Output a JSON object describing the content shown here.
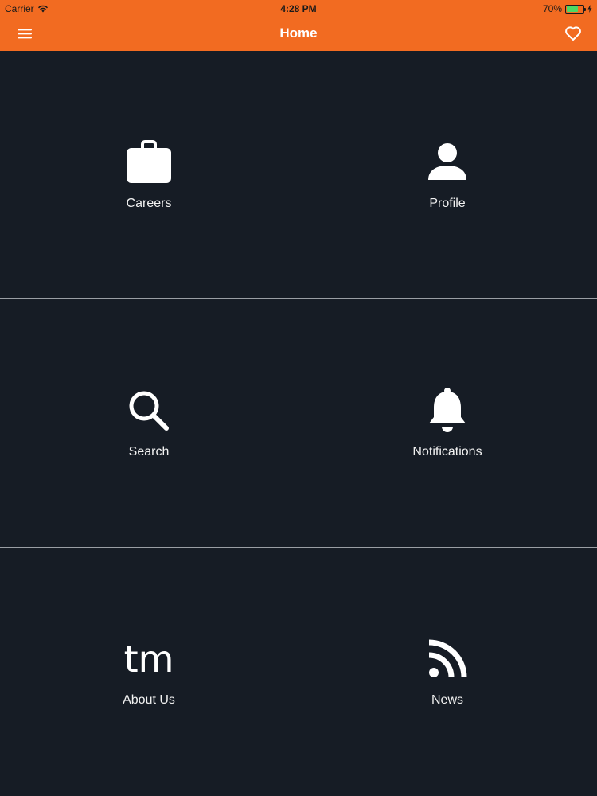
{
  "status": {
    "carrier": "Carrier",
    "time": "4:28 PM",
    "battery_text": "70%",
    "battery_level": 0.7
  },
  "nav": {
    "title": "Home"
  },
  "colors": {
    "accent": "#f26b21",
    "background": "#161c25",
    "divider": "#9a9ea4",
    "text": "#f2f2f2"
  },
  "tiles": [
    {
      "label": "Careers",
      "icon": "briefcase-icon"
    },
    {
      "label": "Profile",
      "icon": "person-icon"
    },
    {
      "label": "Search",
      "icon": "search-icon"
    },
    {
      "label": "Notifications",
      "icon": "bell-icon"
    },
    {
      "label": "About Us",
      "icon": "tm-logo-icon",
      "icon_text": "tm"
    },
    {
      "label": "News",
      "icon": "rss-icon"
    }
  ]
}
